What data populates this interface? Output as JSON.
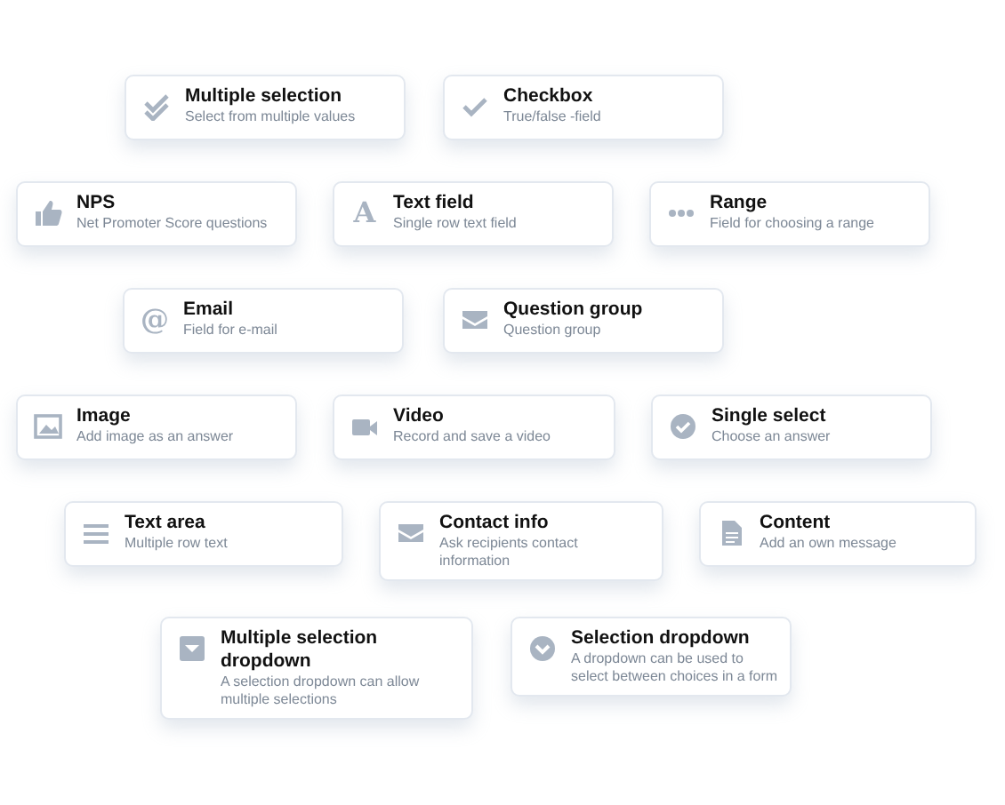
{
  "rows": [
    {
      "cards": [
        {
          "kind": "double-check",
          "title": "Multiple selection",
          "description": "Select from multiple values"
        },
        {
          "kind": "check",
          "title": "Checkbox",
          "description": "True/false -field"
        }
      ]
    },
    {
      "cards": [
        {
          "kind": "thumb",
          "title": "NPS",
          "description": "Net Promoter Score questions"
        },
        {
          "kind": "glyph",
          "glyph": "A",
          "title": "Text field",
          "description": "Single row text field"
        },
        {
          "kind": "dots",
          "title": "Range",
          "description": "Field for choosing a range"
        }
      ]
    },
    {
      "cards": [
        {
          "kind": "glyph",
          "glyph": "@",
          "title": "Email",
          "description": "Field for e-mail"
        },
        {
          "kind": "envelope",
          "title": "Question group",
          "description": "Question group"
        }
      ]
    },
    {
      "cards": [
        {
          "kind": "image",
          "title": "Image",
          "description": "Add image as an answer"
        },
        {
          "kind": "video",
          "title": "Video",
          "description": "Record and save a video"
        },
        {
          "kind": "check-circle",
          "title": "Single select",
          "description": "Choose an answer"
        }
      ]
    },
    {
      "cards": [
        {
          "kind": "lines",
          "title": "Text area",
          "description": "Multiple row text"
        },
        {
          "kind": "envelope",
          "title": "Contact info",
          "description": "Ask recipients contact information"
        },
        {
          "kind": "document",
          "title": "Content",
          "description": "Add an own message"
        }
      ]
    },
    {
      "cards": [
        {
          "kind": "dropdown-box",
          "title": "Multiple selection dropdown",
          "description": "A selection dropdown can allow multiple selections"
        },
        {
          "kind": "chevron-circle",
          "title": "Selection dropdown",
          "description": "A dropdown can be used to select between choices in a form"
        }
      ]
    }
  ]
}
